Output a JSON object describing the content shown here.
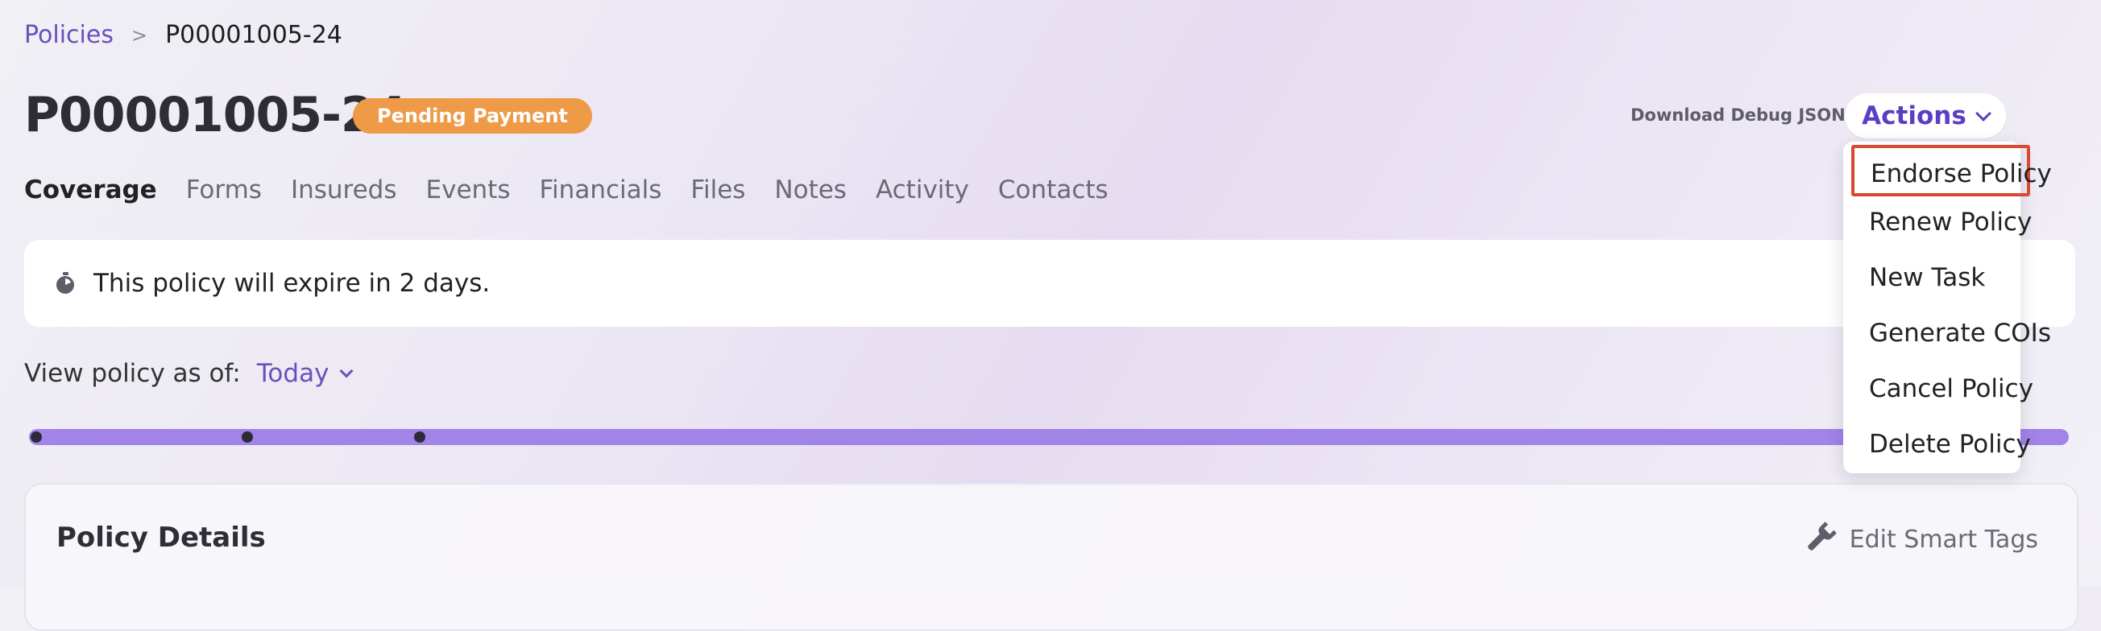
{
  "breadcrumb": {
    "parent": "Policies",
    "separator": ">",
    "current": "P00001005-24"
  },
  "policy": {
    "number": "P00001005-24",
    "status": "Pending Payment",
    "status_color": "#ee9a47"
  },
  "header": {
    "debug_link": "Download Debug JSON",
    "actions_label": "Actions",
    "accent_color": "#5b3ec3"
  },
  "tabs": [
    {
      "label": "Coverage",
      "active": true
    },
    {
      "label": "Forms"
    },
    {
      "label": "Insureds"
    },
    {
      "label": "Events"
    },
    {
      "label": "Financials"
    },
    {
      "label": "Files"
    },
    {
      "label": "Notes"
    },
    {
      "label": "Activity"
    },
    {
      "label": "Contacts"
    }
  ],
  "alert": {
    "icon": "timer-icon",
    "text": "This policy will expire in 2 days."
  },
  "view_as": {
    "label": "View policy as of:",
    "value": "Today"
  },
  "timeline": {
    "color": "#a283e8",
    "markers": 3
  },
  "details": {
    "title": "Policy Details",
    "edit_label": "Edit Smart Tags",
    "edit_icon": "wrench-icon"
  },
  "actions_menu": {
    "items": [
      {
        "label": "Endorse Policy",
        "highlighted": true
      },
      {
        "label": "Renew Policy"
      },
      {
        "label": "New Task"
      },
      {
        "label": "Generate COIs"
      },
      {
        "label": "Cancel Policy"
      },
      {
        "label": "Delete Policy"
      }
    ],
    "highlight_color": "#d9482f"
  }
}
